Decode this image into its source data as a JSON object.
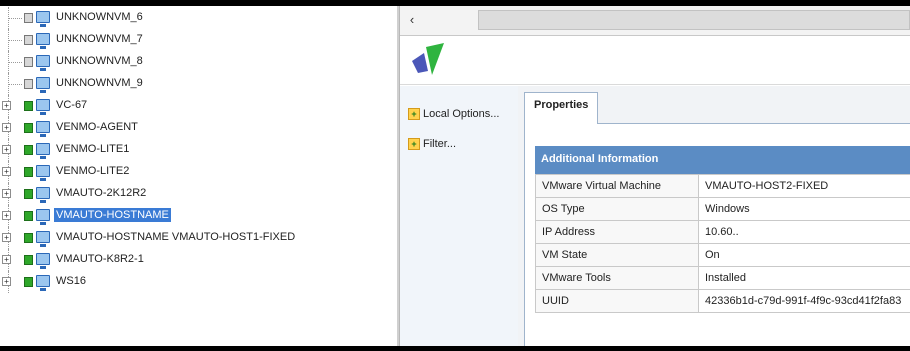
{
  "tree": {
    "items": [
      {
        "label": "UNKNOWNVM_6",
        "expandable": false,
        "state": "off",
        "selected": false
      },
      {
        "label": "UNKNOWNVM_7",
        "expandable": false,
        "state": "off",
        "selected": false
      },
      {
        "label": "UNKNOWNVM_8",
        "expandable": false,
        "state": "off",
        "selected": false
      },
      {
        "label": "UNKNOWNVM_9",
        "expandable": false,
        "state": "off",
        "selected": false
      },
      {
        "label": "VC-67",
        "expandable": true,
        "state": "on",
        "selected": false
      },
      {
        "label": "VENMO-AGENT",
        "expandable": true,
        "state": "on",
        "selected": false
      },
      {
        "label": "VENMO-LITE1",
        "expandable": true,
        "state": "on",
        "selected": false
      },
      {
        "label": "VENMO-LITE2",
        "expandable": true,
        "state": "on",
        "selected": false
      },
      {
        "label": "VMAUTO-2K12R2",
        "expandable": true,
        "state": "on",
        "selected": false
      },
      {
        "label": "VMAUTO-HOSTNAME",
        "expandable": true,
        "state": "on",
        "selected": true
      },
      {
        "label": "VMAUTO-HOSTNAME VMAUTO-HOST1-FIXED",
        "expandable": true,
        "state": "on",
        "selected": false
      },
      {
        "label": "VMAUTO-K8R2-1",
        "expandable": true,
        "state": "on",
        "selected": false
      },
      {
        "label": "WS16",
        "expandable": true,
        "state": "on",
        "selected": false
      }
    ]
  },
  "scrollbar": {
    "left_arrow": "‹"
  },
  "actions": [
    {
      "label": "Local Options..."
    },
    {
      "label": "Filter..."
    }
  ],
  "tabs": [
    {
      "label": "Properties"
    }
  ],
  "section": {
    "title": "Additional Information"
  },
  "properties": [
    {
      "key": "VMware Virtual Machine",
      "value": "VMAUTO-HOST2-FIXED"
    },
    {
      "key": "OS Type",
      "value": "Windows"
    },
    {
      "key": "IP Address",
      "value": "10.60.."
    },
    {
      "key": "VM State",
      "value": "On"
    },
    {
      "key": "VMware Tools",
      "value": "Installed"
    },
    {
      "key": "UUID",
      "value": "42336b1d-c79d-991f-4f9c-93cd41f2fa83"
    }
  ],
  "colors": {
    "selection": "#3a7bd5",
    "section_header": "#5b8cc4",
    "running_state": "#2fa72a"
  }
}
